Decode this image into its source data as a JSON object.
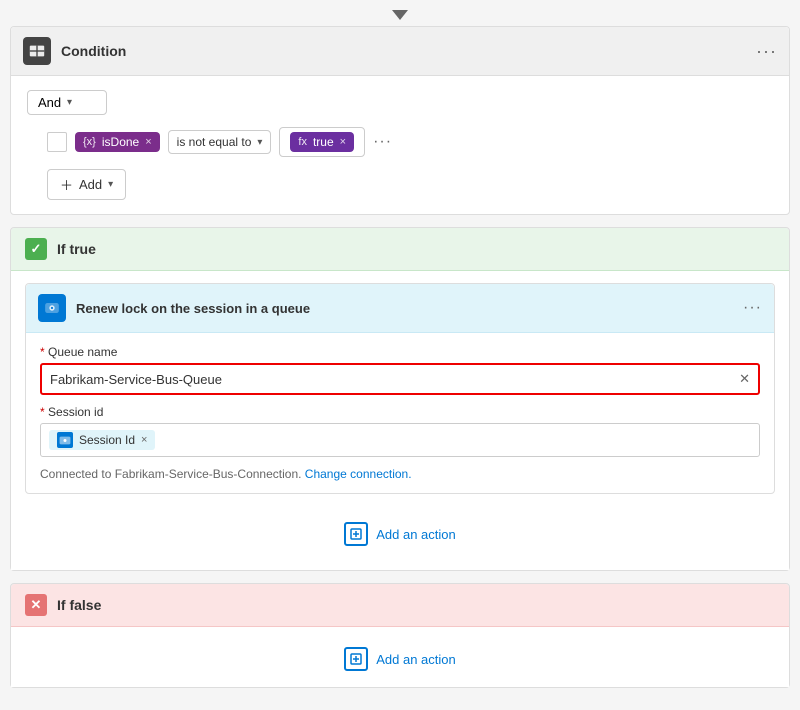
{
  "top_arrow": "↓",
  "condition": {
    "header_icon": "condition-icon",
    "title": "Condition",
    "menu_dots": "···",
    "and_label": "And",
    "is_done_tag": "isDone",
    "operator": "is not equal to",
    "true_value": "true",
    "add_label": "Add"
  },
  "if_true": {
    "label": "If true",
    "action": {
      "title": "Renew lock on the session in a queue",
      "menu_dots": "···",
      "queue_name_label": "Queue name",
      "queue_name_value": "Fabrikam-Service-Bus-Queue",
      "session_id_label": "Session id",
      "session_id_value": "Session Id",
      "connection_text": "Connected to Fabrikam-Service-Bus-Connection.",
      "change_connection_text": "Change connection."
    },
    "add_action_label": "Add an action"
  },
  "if_false": {
    "label": "If false",
    "add_action_label": "Add an action"
  }
}
